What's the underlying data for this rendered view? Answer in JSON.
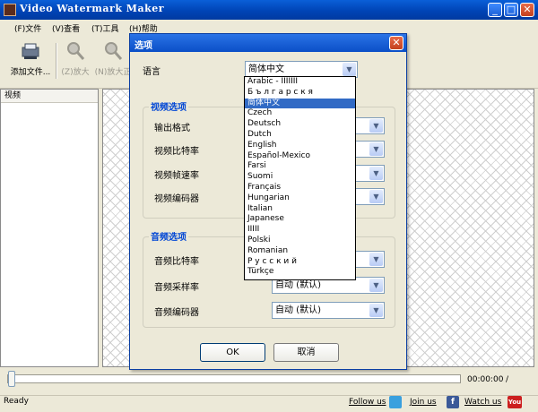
{
  "window": {
    "title": "Video Watermark Maker",
    "minimize": "_",
    "maximize": "□",
    "close": "✕"
  },
  "menu": [
    "(F)文件",
    "(V)查看",
    "(T)工具",
    "(H)帮助"
  ],
  "toolbar": {
    "add_file": "添加文件...",
    "zoom_in": "(Z)放大",
    "zoom_fit": "(N)放大正"
  },
  "left_panel": {
    "header": "视频"
  },
  "player": {
    "time_current": "00:00:00",
    "time_sep": "/"
  },
  "status": {
    "text": "Ready",
    "follow": "Follow us",
    "join": "Join us",
    "watch": "Watch us",
    "facebook_letter": "f",
    "youtube_label": "You"
  },
  "dialog": {
    "title": "选项",
    "close": "✕",
    "language_label": "语言",
    "language_value": "简体中文",
    "video_group": "视频选项",
    "video_labels": [
      "输出格式",
      "视频比特率",
      "视频帧速率",
      "视频编码器"
    ],
    "audio_group": "音频选项",
    "audio_labels": [
      "音频比特率",
      "音频采样率",
      "音频编码器"
    ],
    "audio_values": [
      "",
      "自动 (默认)",
      "自动 (默认)"
    ],
    "ok": "OK",
    "cancel": "取消"
  },
  "languages": [
    "Arabic - IIIIIII",
    "Б ъ л г а р с к я",
    "简体中文",
    "Czech",
    "Deutsch",
    "Dutch",
    "English",
    "Español-Mexico",
    "Farsi",
    "Suomi",
    "Français",
    "Hungarian",
    "Italian",
    "Japanese",
    "IIIII",
    "Polski",
    "Romanian",
    "Р у с с к и й",
    "Türkçe"
  ],
  "selected_language_index": 2,
  "colors": {
    "title_blue": "#0044b6",
    "group_title": "#0046d5",
    "selection": "#316ac5"
  }
}
